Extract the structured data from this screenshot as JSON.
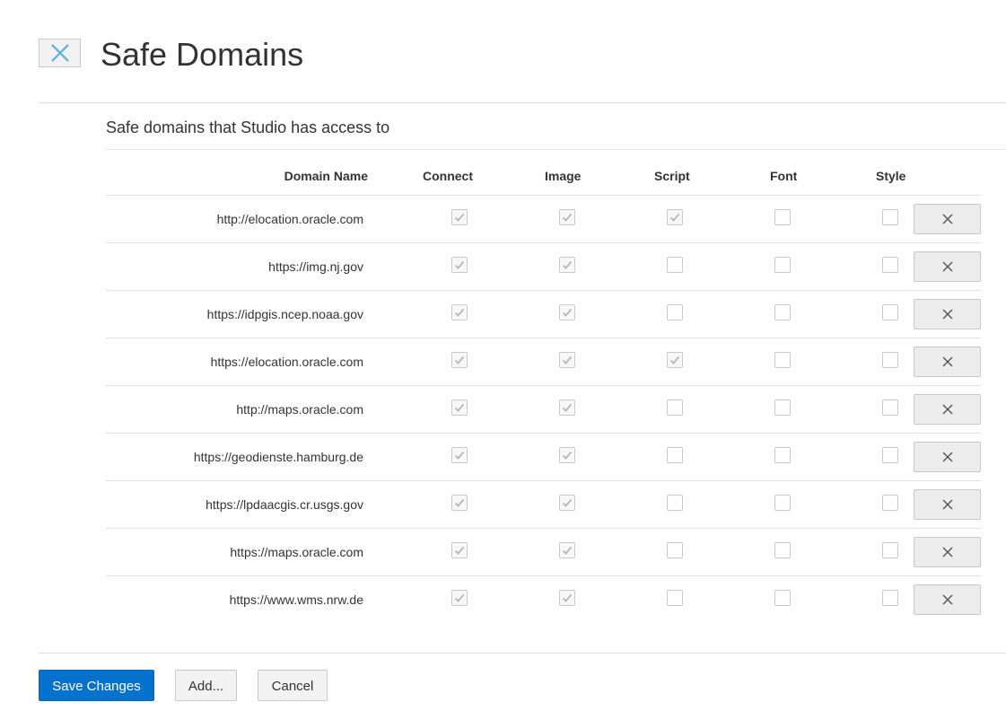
{
  "dialog": {
    "title": "Safe Domains",
    "close_icon": "close-icon",
    "subtitle": "Safe domains that Studio has access to"
  },
  "table": {
    "columns": [
      "Domain Name",
      "Connect",
      "Image",
      "Script",
      "Font",
      "Style"
    ],
    "rows": [
      {
        "domain": "http://elocation.oracle.com",
        "connect": true,
        "image": true,
        "script": true,
        "font": false,
        "style": false
      },
      {
        "domain": "https://img.nj.gov",
        "connect": true,
        "image": true,
        "script": false,
        "font": false,
        "style": false
      },
      {
        "domain": "https://idpgis.ncep.noaa.gov",
        "connect": true,
        "image": true,
        "script": false,
        "font": false,
        "style": false
      },
      {
        "domain": "https://elocation.oracle.com",
        "connect": true,
        "image": true,
        "script": true,
        "font": false,
        "style": false
      },
      {
        "domain": "http://maps.oracle.com",
        "connect": true,
        "image": true,
        "script": false,
        "font": false,
        "style": false
      },
      {
        "domain": "https://geodienste.hamburg.de",
        "connect": true,
        "image": true,
        "script": false,
        "font": false,
        "style": false
      },
      {
        "domain": "https://lpdaacgis.cr.usgs.gov",
        "connect": true,
        "image": true,
        "script": false,
        "font": false,
        "style": false
      },
      {
        "domain": "https://maps.oracle.com",
        "connect": true,
        "image": true,
        "script": false,
        "font": false,
        "style": false
      },
      {
        "domain": "https://www.wms.nrw.de",
        "connect": true,
        "image": true,
        "script": false,
        "font": false,
        "style": false
      }
    ],
    "delete_icon": "close-icon"
  },
  "footer": {
    "save_label": "Save Changes",
    "add_label": "Add...",
    "cancel_label": "Cancel"
  },
  "colors": {
    "primary": "#0572ce",
    "close_icon": "#5aaee0",
    "check": "#b5b5b5"
  }
}
